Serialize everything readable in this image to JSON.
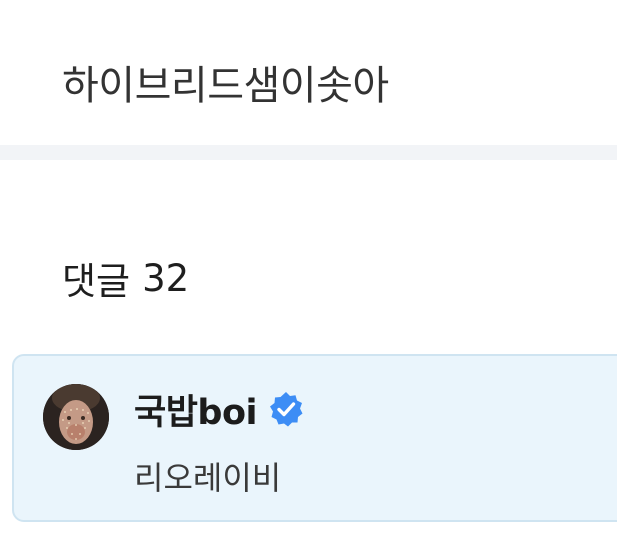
{
  "post": {
    "text": "하이브리드샘이솟아"
  },
  "comments": {
    "label": "댓글",
    "count": "32"
  },
  "comment_list": [
    {
      "author": "국밥boi",
      "verified": true,
      "text": "리오레이비"
    }
  ],
  "colors": {
    "divider": "#f2f4f7",
    "comment_bg": "#eaf5fc",
    "comment_border": "#cfe4f1",
    "verified_badge": "#3d8df5"
  },
  "icons": {
    "avatar": "user-avatar",
    "verified": "verified-badge-icon"
  }
}
